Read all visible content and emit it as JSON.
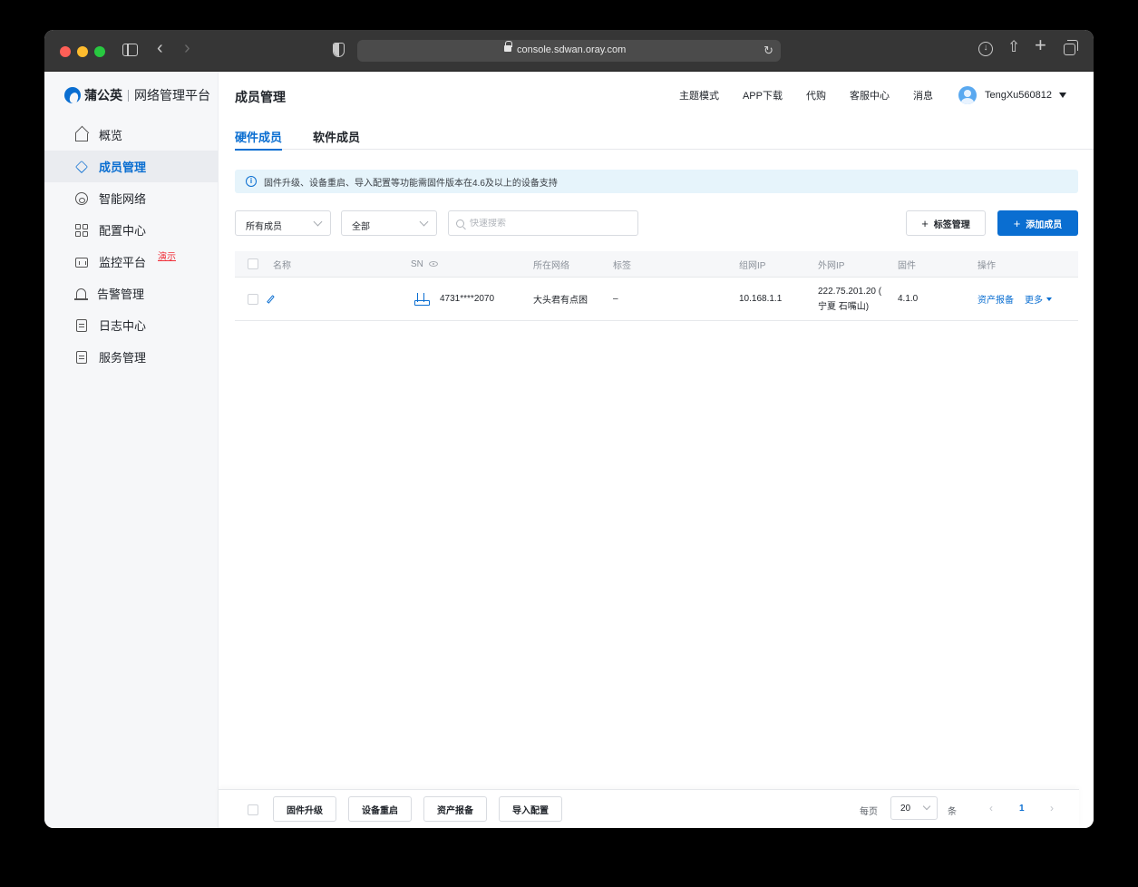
{
  "browser": {
    "url": "console.sdwan.oray.com"
  },
  "sidebar": {
    "brand": "蒲公英",
    "brand_sub": "网络管理平台",
    "items": [
      {
        "label": "概览",
        "icon": "home-icon"
      },
      {
        "label": "成员管理",
        "icon": "layers-icon",
        "active": true
      },
      {
        "label": "智能网络",
        "icon": "network-icon"
      },
      {
        "label": "配置中心",
        "icon": "grid-icon"
      },
      {
        "label": "监控平台",
        "icon": "monitor-icon",
        "badge": "演示"
      },
      {
        "label": "告警管理",
        "icon": "bell-icon"
      },
      {
        "label": "日志中心",
        "icon": "clipboard-icon"
      },
      {
        "label": "服务管理",
        "icon": "document-icon"
      }
    ]
  },
  "header": {
    "title": "成员管理",
    "nav": [
      "主题模式",
      "APP下载",
      "代购",
      "客服中心",
      "消息"
    ],
    "username": "TengXu560812"
  },
  "tabs": [
    {
      "label": "硬件成员",
      "active": true
    },
    {
      "label": "软件成员",
      "active": false
    }
  ],
  "notice": "固件升级、设备重启、导入配置等功能需固件版本在4.6及以上的设备支持",
  "filters": {
    "member_type": "所有成员",
    "scope": "全部",
    "search_placeholder": "快速搜索",
    "tag_button": "标签管理",
    "add_button": "添加成员"
  },
  "table": {
    "columns": [
      "名称",
      "SN",
      "所在网络",
      "标签",
      "组网IP",
      "外网IP",
      "固件",
      "操作"
    ],
    "rows": [
      {
        "name": "",
        "sn": "4731****2070",
        "network": "大头君有点困",
        "tag": "–",
        "lan_ip": "10.168.1.1",
        "wan_ip_line1": "222.75.201.20 (",
        "wan_ip_line2": "宁夏 石嘴山)",
        "firmware": "4.1.0",
        "action_report": "资产报备",
        "action_more": "更多"
      }
    ]
  },
  "footer": {
    "buttons": [
      "固件升级",
      "设备重启",
      "资产报备",
      "导入配置"
    ],
    "per_page_label": "每页",
    "page_size": "20",
    "unit": "条",
    "current_page": "1"
  },
  "colors": {
    "primary": "#0a6ed1",
    "notice_bg": "#e6f4fb",
    "demo_badge": "#f0323c"
  }
}
